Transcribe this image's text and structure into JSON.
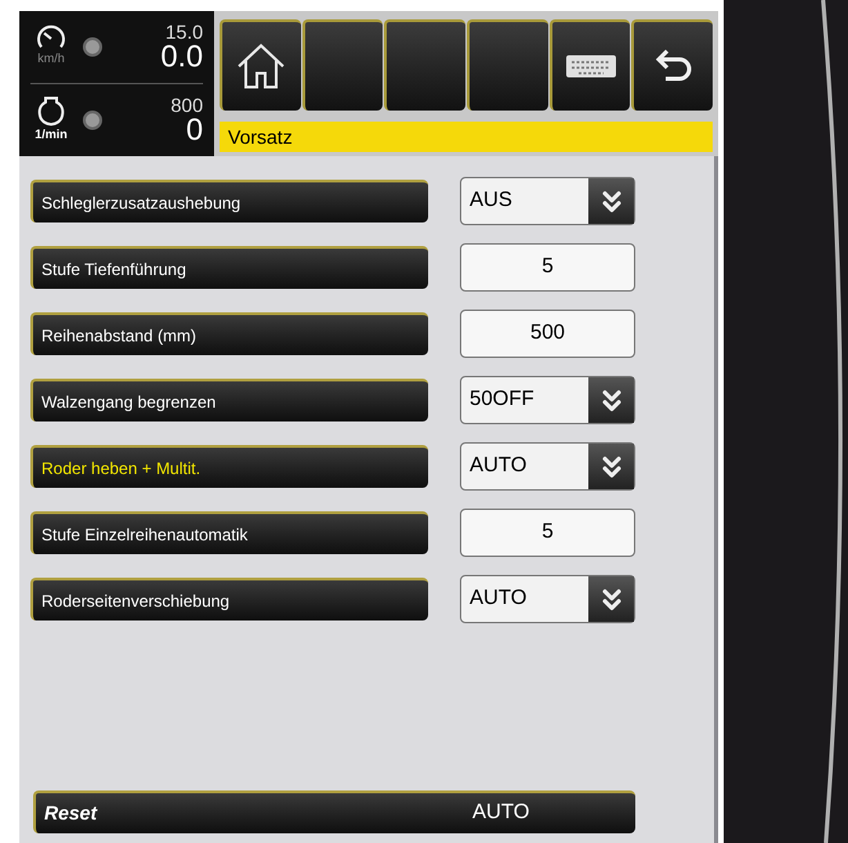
{
  "gauges": [
    {
      "kind": "speed",
      "max": "15.0",
      "value": "0.0",
      "unit": "km/h"
    },
    {
      "kind": "engine",
      "max": "800",
      "value": "0",
      "unit": "1/min"
    }
  ],
  "toolbar": [
    {
      "kind": "home"
    },
    {
      "kind": "blank"
    },
    {
      "kind": "blank"
    },
    {
      "kind": "blank"
    },
    {
      "kind": "keyboard"
    },
    {
      "kind": "back"
    }
  ],
  "header": "Vorsatz",
  "rows": [
    {
      "label": "Schleglerzusatzaushebung",
      "kind": "dropdown",
      "value": "AUS",
      "selected": false
    },
    {
      "label": "Stufe Tiefenführung",
      "kind": "number",
      "value": "5",
      "selected": false
    },
    {
      "label": "Reihenabstand (mm)",
      "kind": "number",
      "value": "500",
      "selected": false
    },
    {
      "label": "Walzengang begrenzen",
      "kind": "dropdown",
      "value": "50OFF",
      "selected": false
    },
    {
      "label": "Roder heben + Multit.",
      "kind": "dropdown",
      "value": "AUTO",
      "selected": true
    },
    {
      "label": "Stufe Einzelreihenautomatik",
      "kind": "number",
      "value": "5",
      "selected": false
    },
    {
      "label": "Roderseitenverschiebung",
      "kind": "dropdown",
      "value": "AUTO",
      "selected": false
    }
  ],
  "reset": {
    "label": "Reset",
    "value": "AUTO"
  }
}
